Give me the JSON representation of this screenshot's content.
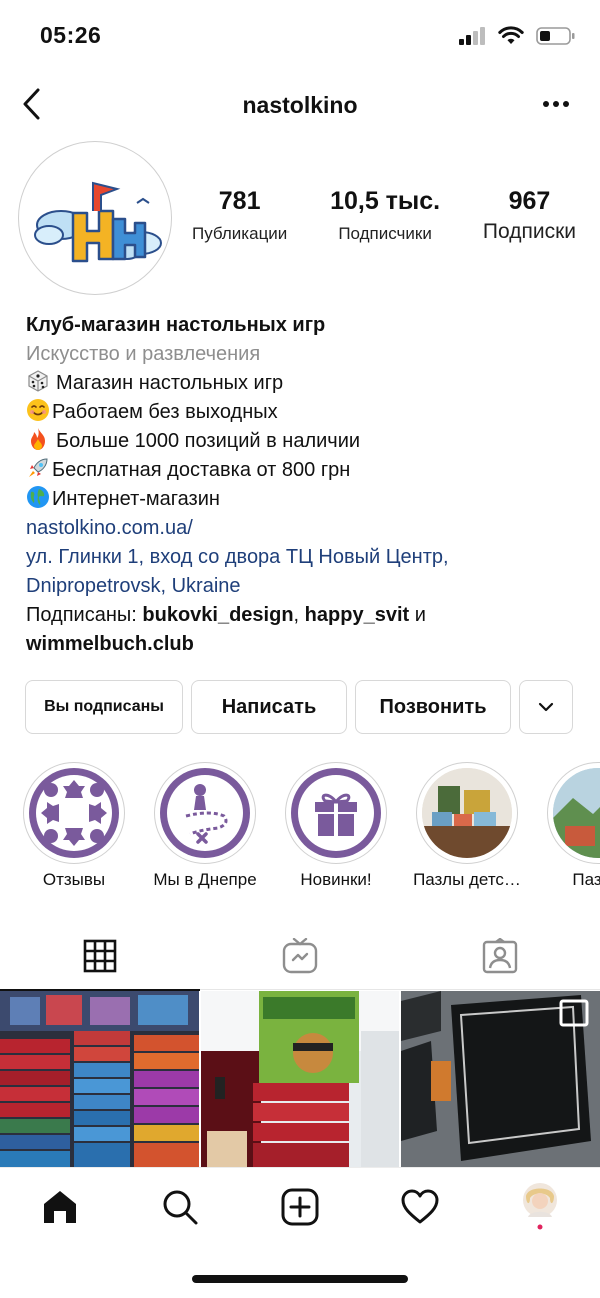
{
  "status": {
    "time": "05:26"
  },
  "header": {
    "username": "nastolkino"
  },
  "stats": {
    "posts_count": "781",
    "posts_label": "Публикации",
    "followers_count": "10,5 тыс.",
    "followers_label": "Подписчики",
    "following_count": "967",
    "following_label": "Подписки"
  },
  "bio": {
    "name": "Клуб-магазин настольных игр",
    "category": "Искусство и развлечения",
    "lines": [
      "Магазин настольных игр",
      "Работаем без выходных",
      "Больше 1000 позиций в наличии",
      "Бесплатная доставка от 800 грн",
      "Интернет-магазин"
    ],
    "website": "nastolkino.com.ua/",
    "address_line1": "ул. Глинки 1, вход со двора ТЦ Новый Центр,",
    "address_line2": "Dnipropetrovsk, Ukraine",
    "followed_by_prefix": "Подписаны: ",
    "followed_by_user1": "bukovki_design",
    "followed_by_sep": ", ",
    "followed_by_user2": "happy_svit",
    "followed_by_and": " и",
    "followed_by_user3": "wimmelbuch.club"
  },
  "actions": {
    "following_label": "Вы подписаны",
    "message_label": "Написать",
    "call_label": "Позвонить"
  },
  "highlights": [
    {
      "label": "Отзывы",
      "icon": "meeple-ring-icon"
    },
    {
      "label": "Мы в Днепре",
      "icon": "pawn-path-icon"
    },
    {
      "label": "Новинки!",
      "icon": "gift-icon"
    },
    {
      "label": "Пазлы детс…",
      "icon": "photo-thumbnail"
    },
    {
      "label": "Пазлы",
      "icon": "photo-thumbnail"
    }
  ],
  "tabs": [
    {
      "name": "grid",
      "icon": "grid-icon"
    },
    {
      "name": "igtv",
      "icon": "tv-icon"
    },
    {
      "name": "tagged",
      "icon": "tagged-person-icon"
    }
  ],
  "posts": [
    {
      "description": "Shelves of boxed board games"
    },
    {
      "description": "Board game box on display"
    },
    {
      "description": "Gradus party game box"
    }
  ],
  "colors": {
    "highlight_purple": "#7a5a9c",
    "link_blue": "#1f3f7a",
    "category_gray": "#8e8e8e"
  }
}
